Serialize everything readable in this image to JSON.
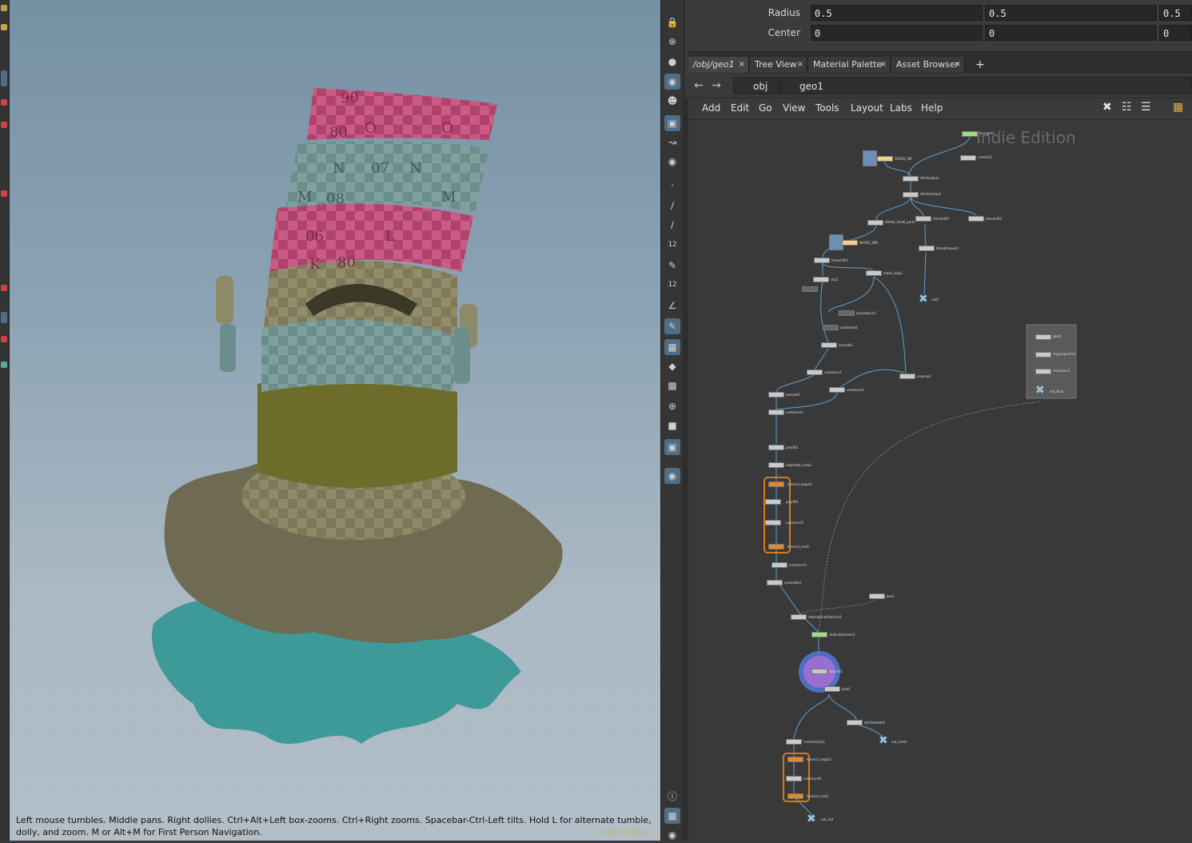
{
  "viewport": {
    "help_text": "Left mouse tumbles. Middle pans. Right dollies. Ctrl+Alt+Left box-zooms. Ctrl+Right zooms. Spacebar-Ctrl-Left tilts. Hold L for alternate tumble, dolly, and zoom. M or Alt+M for First Person Navigation.",
    "watermark": "Indie Edition",
    "mesh_labels": [
      "90",
      "O",
      "80",
      "O",
      "N",
      "07",
      "N",
      "M",
      "08",
      "M",
      "L",
      "06",
      "K",
      "80"
    ]
  },
  "viewport_toolbar": {
    "icons": [
      "lock-icon",
      "close-icon",
      "sphere-icon",
      "ghost-icon",
      "skull-icon",
      "camera-icon",
      "bone-icon",
      "camera-capture-icon",
      "dot-icon",
      "brush-icon",
      "pen-icon",
      "points-icon",
      "edit-icon",
      "points-icon",
      "angle-icon",
      "pencil-icon",
      "grid-icon",
      "cube-icon",
      "texture-icon",
      "compass-icon",
      "stop-icon",
      "image-icon",
      "pin-icon",
      "info-icon",
      "grid-icon",
      "eye-icon"
    ],
    "counter_label_1": "12",
    "counter_label_2": "12"
  },
  "parameters": {
    "radius": {
      "label": "Radius",
      "values": [
        "0.5",
        "0.5",
        "0.5"
      ]
    },
    "center": {
      "label": "Center",
      "values": [
        "0",
        "0",
        "0"
      ]
    }
  },
  "tabs": [
    {
      "label": "/obj/geo1",
      "active": true
    },
    {
      "label": "Tree View",
      "active": false
    },
    {
      "label": "Material Palette",
      "active": false
    },
    {
      "label": "Asset Browser",
      "active": false
    }
  ],
  "path": {
    "root": "obj",
    "current": "geo1"
  },
  "menu": [
    "Add",
    "Edit",
    "Go",
    "View",
    "Tools",
    "Layout",
    "Labs",
    "Help"
  ],
  "network": {
    "watermark": "Indie Edition",
    "node_labels": [
      "wrangle1",
      "convert1",
      "WOOD_SM",
      "attribadjust",
      "attribremap1",
      "delete_small_parts",
      "timeshift2",
      "timeshift3",
      "WOOD_SM1",
      "blendshapes1",
      "timeshift4",
      "make_loop1",
      "clip1",
      "null1",
      "polyreduce1",
      "subdivide1",
      "extrude1",
      "uvtexture1",
      "unwrap1",
      "uvtexture2",
      "polyfill1",
      "exploded_view1",
      "foreach_begin1",
      "polyfill1",
      "uvtexture5",
      "foreach_end1",
      "transform1",
      "assemble1",
      "rbdmaterialfracture1",
      "box1",
      "rbdbulletsolver1",
      "dopnet1",
      "split1",
      "attribdelete1",
      "connectivity1",
      "foreach_begin2",
      "uvtexture6",
      "foreach_end2",
      "out_rbd",
      "out_mesh",
      "geo0",
      "copytopoints1",
      "mountain1",
      "out_floor"
    ]
  }
}
